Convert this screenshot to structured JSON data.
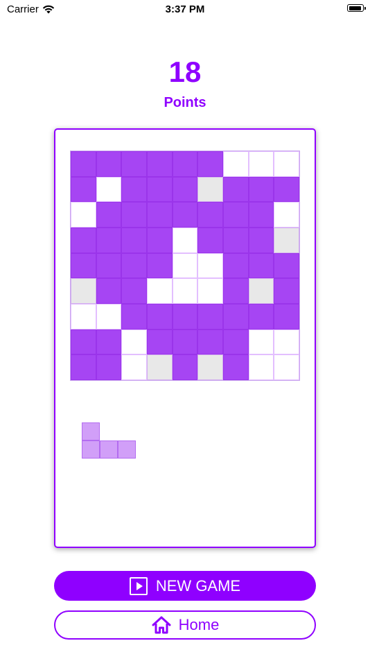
{
  "status": {
    "carrier": "Carrier",
    "time": "3:37 PM"
  },
  "score": {
    "value": "18",
    "label": "Points"
  },
  "board": {
    "rows": [
      [
        "F",
        "F",
        "F",
        "F",
        "F",
        "F",
        "E",
        "E",
        "E"
      ],
      [
        "F",
        "E",
        "F",
        "F",
        "F",
        "B",
        "F",
        "F",
        "F"
      ],
      [
        "E",
        "F",
        "F",
        "F",
        "F",
        "F",
        "F",
        "F",
        "E"
      ],
      [
        "F",
        "F",
        "F",
        "F",
        "E",
        "F",
        "F",
        "F",
        "B"
      ],
      [
        "F",
        "F",
        "F",
        "F",
        "E",
        "E",
        "F",
        "F",
        "F"
      ],
      [
        "B",
        "F",
        "F",
        "E",
        "E",
        "E",
        "F",
        "B",
        "F"
      ],
      [
        "E",
        "E",
        "F",
        "F",
        "F",
        "F",
        "F",
        "F",
        "F"
      ],
      [
        "F",
        "F",
        "E",
        "F",
        "F",
        "F",
        "F",
        "E",
        "E"
      ],
      [
        "F",
        "F",
        "E",
        "B",
        "F",
        "B",
        "F",
        "E",
        "E"
      ]
    ],
    "legend": {
      "F": "filled",
      "E": "empty",
      "B": "blocked"
    }
  },
  "next_piece": {
    "cells": [
      [
        0,
        0
      ],
      [
        1,
        0
      ],
      [
        1,
        1
      ],
      [
        1,
        2
      ]
    ]
  },
  "buttons": {
    "new_game": "NEW GAME",
    "home": "Home"
  },
  "colors": {
    "accent": "#8f00ff",
    "filled": "#a645f3",
    "piece": "#d19ff8",
    "blocked": "#e8e8e8"
  }
}
